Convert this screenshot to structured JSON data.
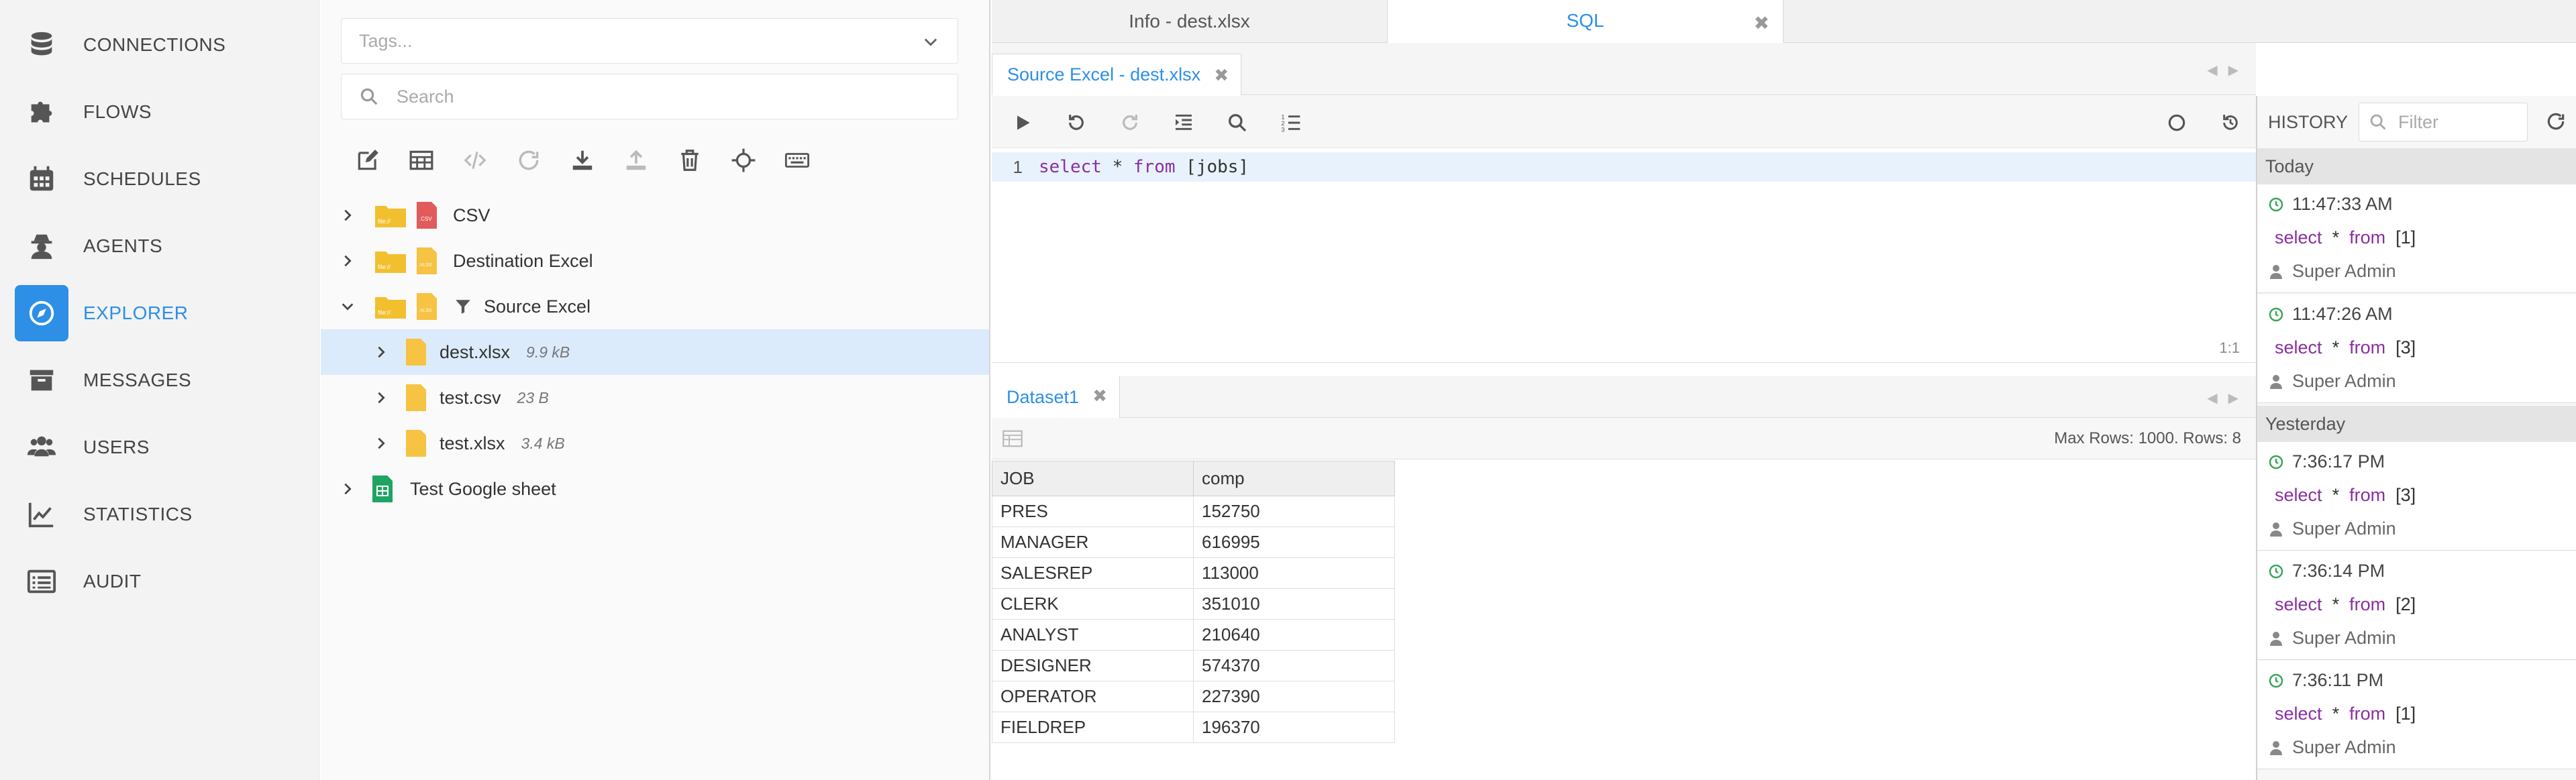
{
  "nav": {
    "items": [
      {
        "label": "CONNECTIONS",
        "icon": "database-icon"
      },
      {
        "label": "FLOWS",
        "icon": "puzzle-icon"
      },
      {
        "label": "SCHEDULES",
        "icon": "calendar-icon"
      },
      {
        "label": "AGENTS",
        "icon": "agent-icon"
      },
      {
        "label": "EXPLORER",
        "icon": "compass-icon",
        "active": true
      },
      {
        "label": "MESSAGES",
        "icon": "archive-icon"
      },
      {
        "label": "USERS",
        "icon": "users-icon"
      },
      {
        "label": "STATISTICS",
        "icon": "chart-line-icon"
      },
      {
        "label": "AUDIT",
        "icon": "list-icon"
      }
    ]
  },
  "explorer": {
    "tags_placeholder": "Tags...",
    "search_placeholder": "Search",
    "tree": [
      {
        "label": "CSV",
        "type": "csv",
        "level": 0,
        "expanded": false
      },
      {
        "label": "Destination Excel",
        "type": "excel",
        "level": 0,
        "expanded": false
      },
      {
        "label": "Source Excel",
        "type": "excel",
        "level": 0,
        "expanded": true,
        "filter": true
      },
      {
        "label": "dest.xlsx",
        "size": "9.9 kB",
        "level": 1,
        "selected": true
      },
      {
        "label": "test.csv",
        "size": "23 B",
        "level": 1
      },
      {
        "label": "test.xlsx",
        "size": "3.4 kB",
        "level": 1
      },
      {
        "label": "Test Google sheet",
        "type": "gsheet",
        "level": 0,
        "expanded": false
      }
    ]
  },
  "tabs": {
    "info": "Info - dest.xlsx",
    "sql": "SQL"
  },
  "sql_tab": {
    "source_tab": "Source Excel - dest.xlsx",
    "line_number": "1",
    "code": {
      "kw1": "select",
      "star": " * ",
      "kw2": "from",
      "rest": " [jobs]"
    },
    "cursor_pos": "1:1"
  },
  "results": {
    "tab": "Dataset1",
    "rows_info": "Max Rows: 1000. Rows: 8",
    "columns": [
      "JOB",
      "comp"
    ],
    "rows": [
      [
        "PRES",
        "152750"
      ],
      [
        "MANAGER",
        "616995"
      ],
      [
        "SALESREP",
        "113000"
      ],
      [
        "CLERK",
        "351010"
      ],
      [
        "ANALYST",
        "210640"
      ],
      [
        "DESIGNER",
        "574370"
      ],
      [
        "OPERATOR",
        "227390"
      ],
      [
        "FIELDREP",
        "196370"
      ]
    ]
  },
  "history": {
    "title": "HISTORY",
    "filter_placeholder": "Filter",
    "groups": [
      {
        "label": "Today"
      },
      {
        "label": "Yesterday"
      }
    ],
    "entries": [
      {
        "time": "11:47:33 AM",
        "kw1": "select",
        "star": "*",
        "kw2": "from",
        "target": "[1]",
        "user": "Super Admin"
      },
      {
        "time": "11:47:26 AM",
        "kw1": "select",
        "star": "*",
        "kw2": "from",
        "target": "[3]",
        "user": "Super Admin"
      },
      {
        "time": "7:36:17 PM",
        "kw1": "select",
        "star": "*",
        "kw2": "from",
        "target": "[3]",
        "user": "Super Admin"
      },
      {
        "time": "7:36:14 PM",
        "kw1": "select",
        "star": "*",
        "kw2": "from",
        "target": "[2]",
        "user": "Super Admin"
      },
      {
        "time": "7:36:11 PM",
        "kw1": "select",
        "star": "*",
        "kw2": "from",
        "target": "[1]",
        "user": "Super Admin"
      }
    ]
  },
  "colors": {
    "accent": "#2d8fe6",
    "keyword": "#8a2fa0",
    "selected_row": "#dcebfb"
  }
}
